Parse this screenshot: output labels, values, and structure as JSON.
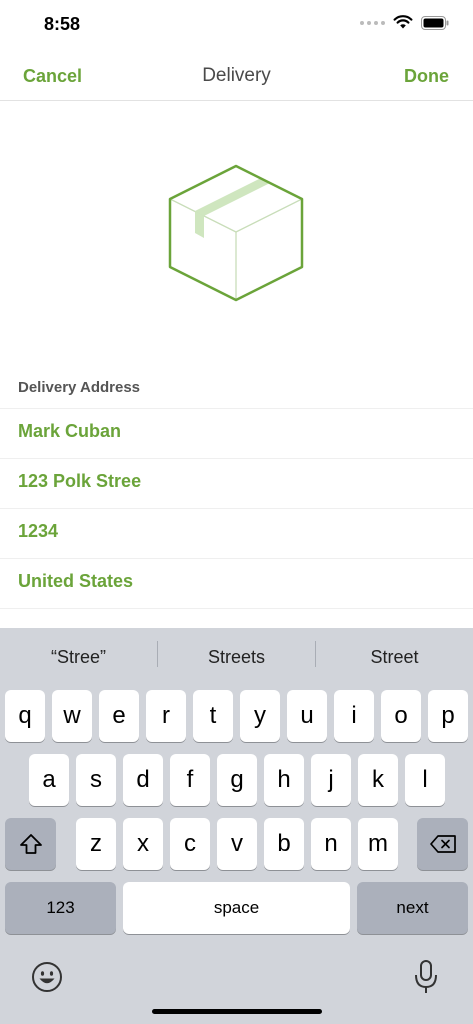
{
  "status_bar": {
    "time": "8:58"
  },
  "nav": {
    "cancel": "Cancel",
    "title": "Delivery",
    "done": "Done"
  },
  "illustration": {
    "name": "package-box",
    "stroke_color": "#6ba43a",
    "tape_color": "#cfe6bf"
  },
  "form": {
    "section_header": "Delivery Address",
    "fields": [
      {
        "value": "Mark Cuban"
      },
      {
        "value": "123 Polk Stree"
      },
      {
        "value": "1234"
      },
      {
        "value": "United States"
      }
    ]
  },
  "keyboard": {
    "suggestions": [
      "“Stree”",
      "Streets",
      "Street"
    ],
    "row1": [
      "q",
      "w",
      "e",
      "r",
      "t",
      "y",
      "u",
      "i",
      "o",
      "p"
    ],
    "row2": [
      "a",
      "s",
      "d",
      "f",
      "g",
      "h",
      "j",
      "k",
      "l"
    ],
    "row3": [
      "z",
      "x",
      "c",
      "v",
      "b",
      "n",
      "m"
    ],
    "numbers_key": "123",
    "space_key": "space",
    "next_key": "next",
    "icons": {
      "shift": "shift-icon",
      "delete": "backspace-icon",
      "emoji": "emoji-icon",
      "mic": "microphone-icon"
    }
  },
  "colors": {
    "accent": "#6ba43a",
    "keyboard_bg": "#d1d4da",
    "dark_key": "#abb0bb"
  }
}
